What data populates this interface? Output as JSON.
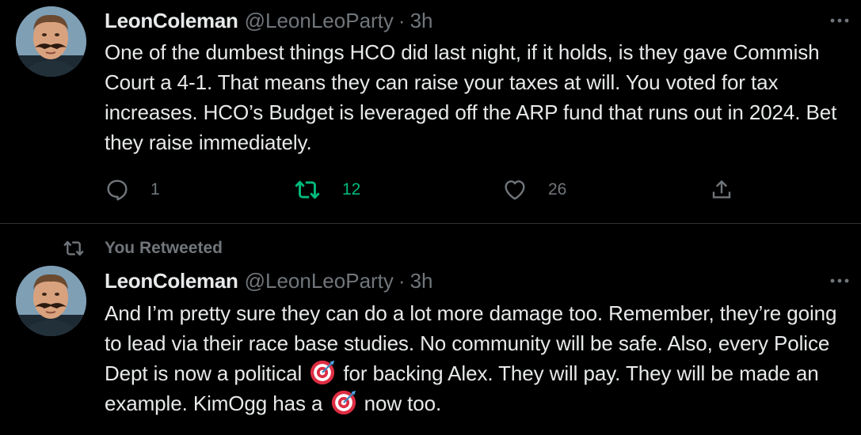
{
  "tweets": [
    {
      "author_name": "LeonColeman",
      "author_handle": "@LeonLeoParty",
      "separator": "·",
      "time": "3h",
      "text": "One of the dumbest things HCO did last night, if it holds, is they gave Commish Court a 4-1. That means they can raise your taxes at will. You voted for tax increases. HCO’s Budget is leveraged off the ARP fund that runs out in 2024. Bet they raise immediately.",
      "reply_count": "1",
      "retweet_count": "12",
      "like_count": "26"
    },
    {
      "retweet_banner": "You Retweeted",
      "author_name": "LeonColeman",
      "author_handle": "@LeonLeoParty",
      "separator": "·",
      "time": "3h",
      "text_parts": [
        "And I’m pretty sure they can do a lot more damage too. Remember, they’re going to lead via their race base studies. No community will be safe. Also, every Police Dept is now a political ",
        " for backing Alex. They will pay. They will be made an example. KimOgg has a ",
        " now too."
      ]
    }
  ],
  "colors": {
    "background": "#000000",
    "text": "#e7e9ea",
    "secondary": "#71767b",
    "retweet_green": "#00ba7c",
    "divider": "#2f3336"
  },
  "icons": {
    "more": "more-icon",
    "reply": "reply-icon",
    "retweet": "retweet-icon",
    "like": "like-icon",
    "share": "share-icon",
    "target_emoji": "direct-hit-emoji"
  }
}
